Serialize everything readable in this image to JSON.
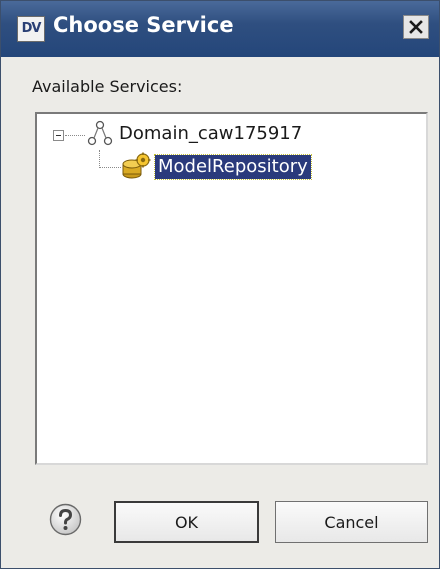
{
  "window": {
    "app_icon_text": "DV",
    "title": "Choose Service"
  },
  "content": {
    "label": "Available Services:"
  },
  "tree": {
    "root": {
      "label": "Domain_caw175917",
      "expanded": true,
      "icon": "domain-network-icon"
    },
    "child": {
      "label": "ModelRepository",
      "selected": true,
      "icon": "model-repository-icon"
    }
  },
  "buttons": {
    "ok": "OK",
    "cancel": "Cancel",
    "help_icon": "help-question-icon"
  },
  "colors": {
    "titlebar": "#2f4f80",
    "selection": "#2a3a7c",
    "dialog_bg": "#ecebe7"
  }
}
